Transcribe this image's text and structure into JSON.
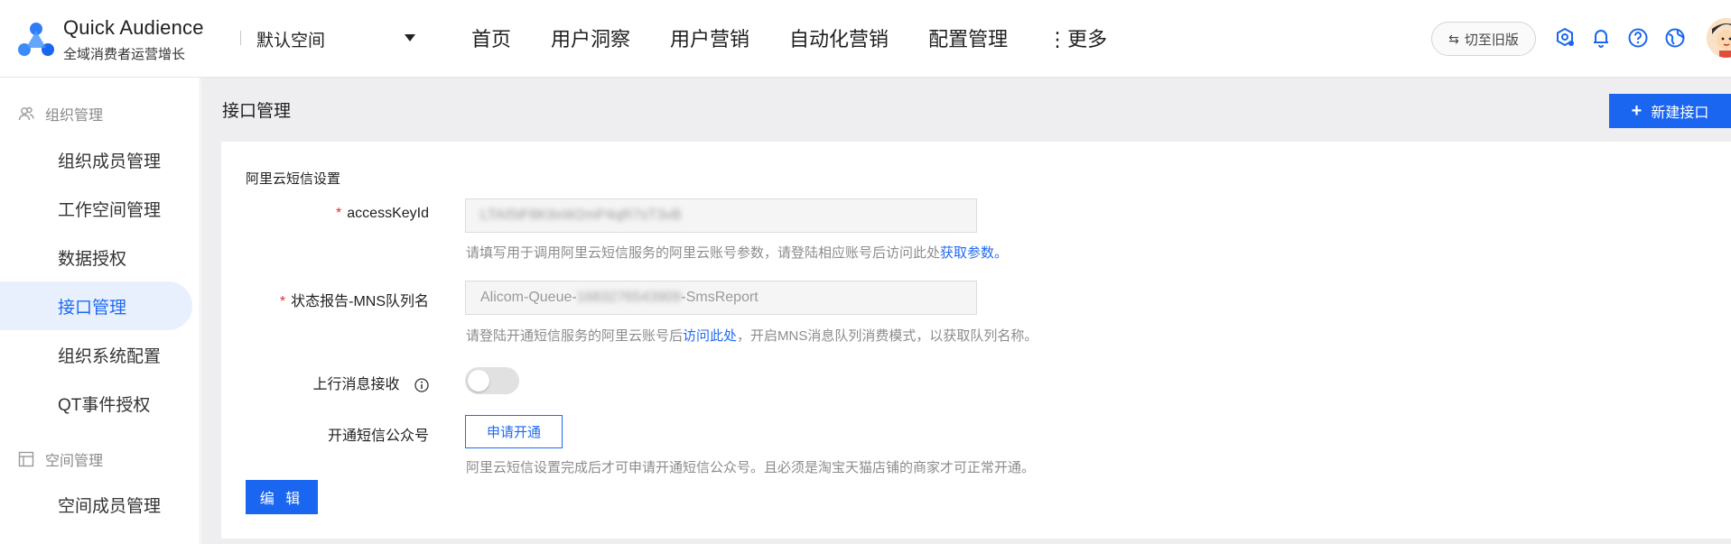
{
  "header": {
    "brand_title": "Quick Audience",
    "brand_subtitle": "全域消费者运营增长",
    "workspace": "默认空间",
    "nav": [
      "首页",
      "用户洞察",
      "用户营销",
      "自动化营销",
      "配置管理",
      "⋮更多"
    ],
    "switch_old_label": "切至旧版",
    "icons": [
      "settings-icon",
      "bell-icon",
      "help-icon",
      "globe-icon"
    ]
  },
  "sidebar": {
    "group1": "组织管理",
    "items1": [
      "组织成员管理",
      "工作空间管理",
      "数据授权",
      "接口管理",
      "组织系统配置",
      "QT事件授权"
    ],
    "group2": "空间管理",
    "items2": [
      "空间成员管理"
    ],
    "active": "接口管理"
  },
  "page": {
    "title": "接口管理",
    "new_button": "新建接口"
  },
  "form": {
    "section_title": "阿里云短信设置",
    "accesskey_label": "accessKeyId",
    "accesskey_value": "LTAI5tF8K9xW2mP4qR7sT3vB",
    "accesskey_hint_prefix": "请填写用于调用阿里云短信服务的阿里云账号参数，请登陆相应账号后访问此处",
    "accesskey_hint_link": "获取参数。",
    "mns_label": "状态报告-MNS队列名",
    "mns_value_prefix": "Alicom-Queue-",
    "mns_value_masked": "1683276543909",
    "mns_value_suffix": "-SmsReport",
    "mns_hint_prefix": "请登陆开通短信服务的阿里云账号后",
    "mns_hint_link": "访问此处",
    "mns_hint_suffix": "，开启MNS消息队列消费模式，以获取队列名称。",
    "upstream_label": "上行消息接收",
    "upstream_enabled": false,
    "public_no_label": "开通短信公众号",
    "apply_button": "申请开通",
    "public_no_hint": "阿里云短信设置完成后才可申请开通短信公众号。且必须是淘宝天猫店铺的商家才可正常开通。",
    "edit_button": "编 辑"
  },
  "colors": {
    "primary": "#1a66f0",
    "active_bg": "#e8f0fe",
    "required": "#e03131"
  }
}
